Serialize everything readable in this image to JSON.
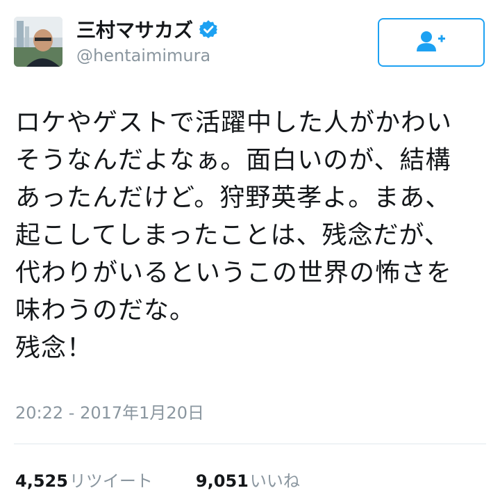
{
  "user": {
    "display_name": "三村マサカズ",
    "handle": "@hentaimimura",
    "verified": true,
    "avatar_icon": "user-avatar-photo"
  },
  "follow_button": {
    "icon": "follow-user-plus-icon",
    "accent_color": "#1da1f2"
  },
  "tweet": {
    "lines": [
      "ロケやゲストで活躍中した人がかわい",
      "そうなんだよなぁ。面白いのが、結構",
      "あったんだけど。狩野英孝よ。まあ、",
      "起こしてしまったことは、残念だが、",
      "代わりがいるというこの世界の怖さを",
      "味わうのだな。",
      "残念！"
    ],
    "timestamp": "20:22 - 2017年1月20日"
  },
  "stats": {
    "retweets_count": "4,525",
    "retweets_label": "リツイート",
    "likes_count": "9,051",
    "likes_label": "いいね"
  }
}
